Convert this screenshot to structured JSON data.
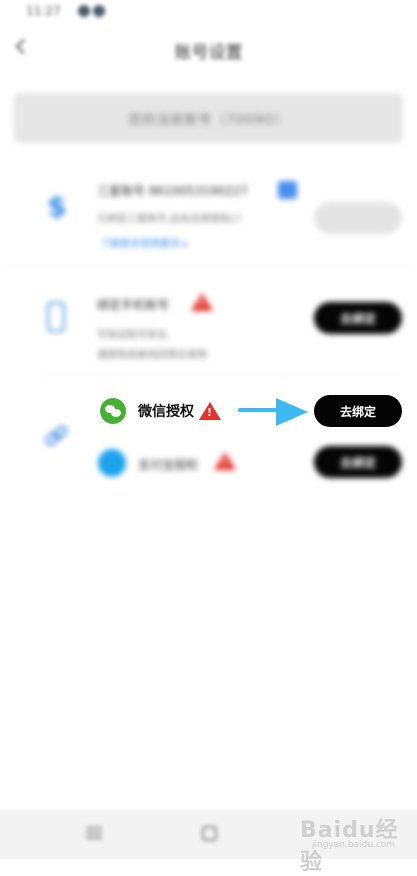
{
  "status_bar": {
    "time": "11:27",
    "right": ""
  },
  "header": {
    "title": "账号设置"
  },
  "account_box": {
    "text": "您的当前账号（7009O）"
  },
  "rows": {
    "yuanshi": {
      "title": "三星账号 8610053190227",
      "subtitle": "已绑定三星账号,此处应用登陆1?",
      "link": "了解更多使用要求 ▸",
      "button": ""
    },
    "phone": {
      "title": "绑定手机账号",
      "line1": "可保证账号安全,",
      "line2": "遇登陆或者找回等在使用",
      "button": "去绑定"
    },
    "auth": {
      "wechat_label": "微信授权",
      "wechat_button": "去绑定",
      "alipay_label": "支付宝授权",
      "alipay_button": "去绑定"
    }
  },
  "watermark": {
    "text": "Baidu经验",
    "sub": "jingyan.baidu.com"
  },
  "colors": {
    "accent_blue": "#3a8ee8",
    "warn_red": "#e5322a",
    "arrow_blue": "#3db8f0",
    "button_black": "#050505"
  }
}
